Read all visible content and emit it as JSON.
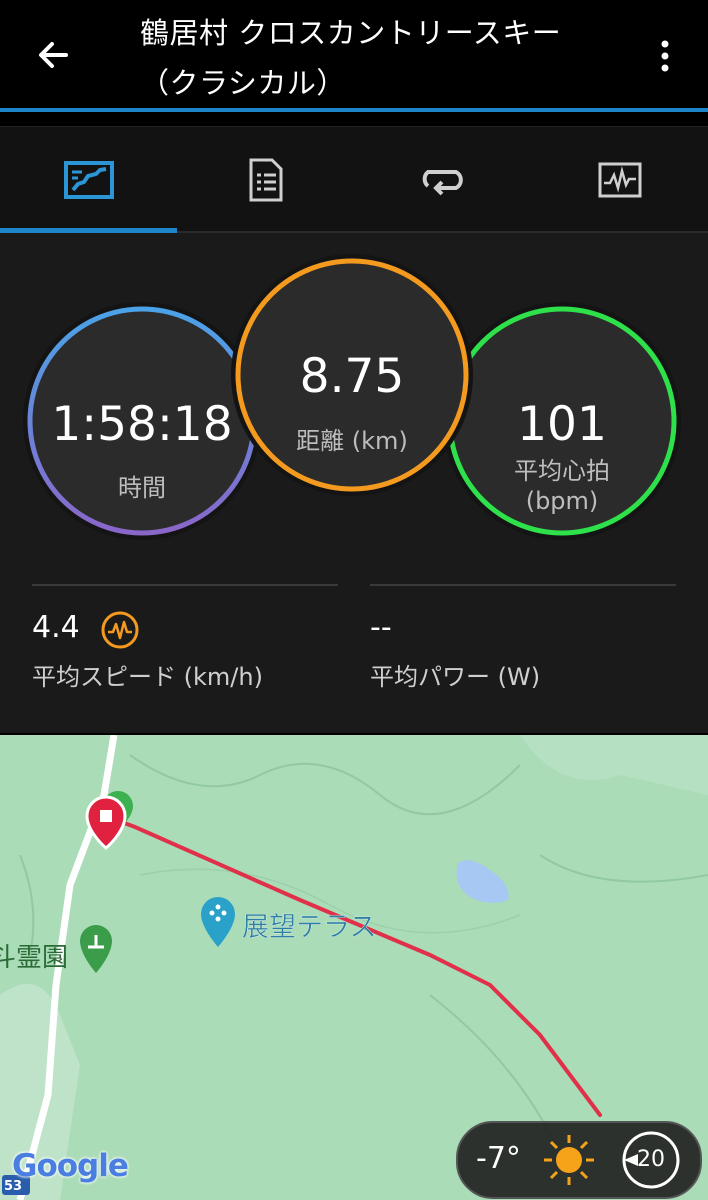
{
  "header": {
    "title_line1": "鶴居村 クロスカントリースキー",
    "title_line2": "（クラシカル）"
  },
  "tabs": [
    {
      "icon": "map-summary-icon",
      "active": true
    },
    {
      "icon": "document-icon",
      "active": false
    },
    {
      "icon": "laps-icon",
      "active": false
    },
    {
      "icon": "chart-icon",
      "active": false
    }
  ],
  "stats": {
    "time_value": "1:58:18",
    "time_label": "時間",
    "distance_value": "8.75",
    "distance_label": "距離 (km)",
    "heart_value": "101",
    "heart_label": "平均心拍",
    "heart_unit": "(bpm)",
    "speed_value": "4.4",
    "speed_label": "平均スピード (km/h)",
    "power_value": "--",
    "power_label": "平均パワー (W)"
  },
  "colors": {
    "accent_blue": "#1c86c8",
    "time_ring_top": "#4aa3e8",
    "time_ring_bottom": "#8a66c9",
    "distance_ring": "#f39a1f",
    "heart_ring": "#2ee04a",
    "route": "#e0304a"
  },
  "map": {
    "poi_label": "展望テラス",
    "cemetery_label": "斗霊園",
    "route_number": "53",
    "google_logo": "Google"
  },
  "weather": {
    "temperature": "-7°",
    "icon": "sun-icon",
    "wind": "20"
  }
}
